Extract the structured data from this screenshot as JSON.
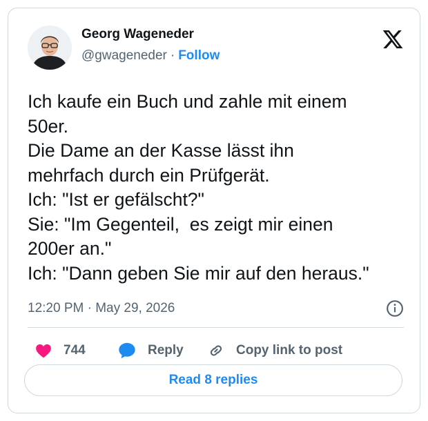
{
  "author": {
    "name": "Georg Wageneder",
    "handle": "@gwageneder",
    "separator": "·",
    "follow_label": "Follow"
  },
  "tweet": {
    "lines": [
      "Ich kaufe ein Buch und zahle mit einem",
      "50er.",
      "Die Dame an der Kasse lässt ihn",
      "mehrfach durch ein Prüfgerät.",
      "Ich: \"Ist er gefälscht?\"",
      "Sie: \"Im Gegenteil,  es zeigt mir einen",
      "200er an.\"",
      "Ich: \"Dann geben Sie mir auf den heraus.\""
    ],
    "timestamp": "12:20 PM · May 29, 2026"
  },
  "actions": {
    "likes": "744",
    "reply_label": "Reply",
    "copy_label": "Copy link to post",
    "read_replies_label": "Read 8 replies"
  },
  "colors": {
    "accent": "#1d8bf0",
    "like": "#f91880",
    "text": "#0f1419",
    "muted": "#536471",
    "border": "#cfd9de"
  },
  "icons": [
    "x-logo-icon",
    "info-icon",
    "heart-icon",
    "reply-bubble-icon",
    "link-icon"
  ]
}
